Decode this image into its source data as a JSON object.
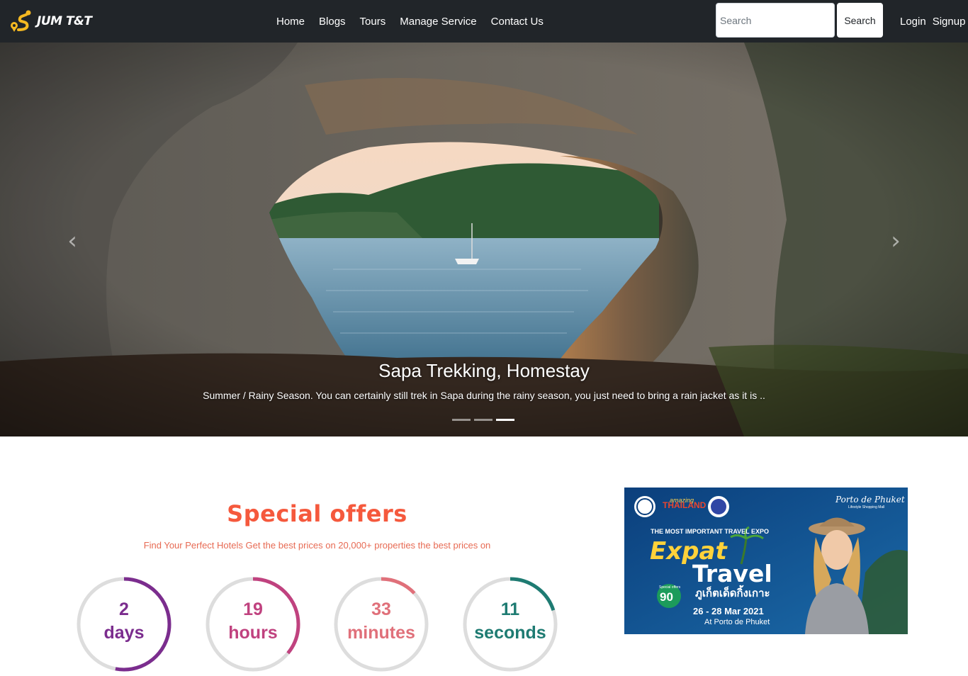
{
  "brand": {
    "name": "JUM T&T",
    "logo_icon": "map-pin-route-icon",
    "accent": "#f5b921"
  },
  "nav": {
    "items": [
      "Home",
      "Blogs",
      "Tours",
      "Manage Service",
      "Contact Us"
    ]
  },
  "search": {
    "placeholder": "Search",
    "button": "Search"
  },
  "auth": {
    "login": "Login",
    "signup": "Signup"
  },
  "hero": {
    "title": "Sapa Trekking, Homestay",
    "text": "Summer / Rainy Season. You can certainly still trek in Sapa during the rainy season, you just need to bring a rain jacket as it is ..",
    "prev_icon": "chevron-left-icon",
    "next_icon": "chevron-right-icon",
    "slides": 3,
    "active_slide": 3
  },
  "offers": {
    "title": "Special offers",
    "subtitle": "Find Your Perfect Hotels Get the best prices on 20,000+ properties the best prices on",
    "timers": [
      {
        "value": "2",
        "unit": "days",
        "color": "#7b2d8e",
        "fraction": 0.53
      },
      {
        "value": "19",
        "unit": "hours",
        "color": "#c0427f",
        "fraction": 0.36
      },
      {
        "value": "33",
        "unit": "minutes",
        "color": "#e0707a",
        "fraction": 0.13
      },
      {
        "value": "11",
        "unit": "seconds",
        "color": "#1e7b72",
        "fraction": 0.2
      }
    ]
  },
  "ad": {
    "brand_right": "Porto de Phuket",
    "brand_right_sub": "Lifestyle Shopping Mall",
    "amazing": "amazing",
    "thailand": "THAILAND",
    "headline": "THE MOST IMPORTANT TRAVEL EXPO",
    "expat": "Expat",
    "travel": "Travel",
    "thai": "ภูเก็ตเด็ดกิ้งเกาะ",
    "special_offers": "Special offers",
    "percent": "90",
    "dates": "26 - 28 Mar 2021",
    "venue": "At Porto de Phuket"
  }
}
